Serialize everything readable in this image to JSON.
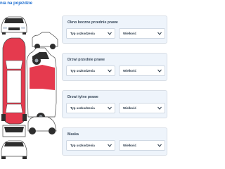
{
  "page": {
    "title": "nia na pojeździe"
  },
  "panels": [
    {
      "title": "Okno boczne przednie prawe",
      "type_label": "Typ uszkodzenia",
      "size_label": "Wielkość"
    },
    {
      "title": "Drzwi przednie prawe",
      "type_label": "Typ uszkodzenia",
      "size_label": "Wielkość"
    },
    {
      "title": "Drzwi tylne prawe",
      "type_label": "Typ uszkodzenia",
      "size_label": "Wielkość"
    },
    {
      "title": "Maska",
      "type_label": "Typ uszkodzenia",
      "size_label": "Wielkość"
    }
  ],
  "colors": {
    "accent": "#1f6fd1",
    "damage": "#e53a4e",
    "car_body": "#ffffff",
    "car_outline": "#4a4a4a",
    "panel_bg": "#eef4fb"
  }
}
